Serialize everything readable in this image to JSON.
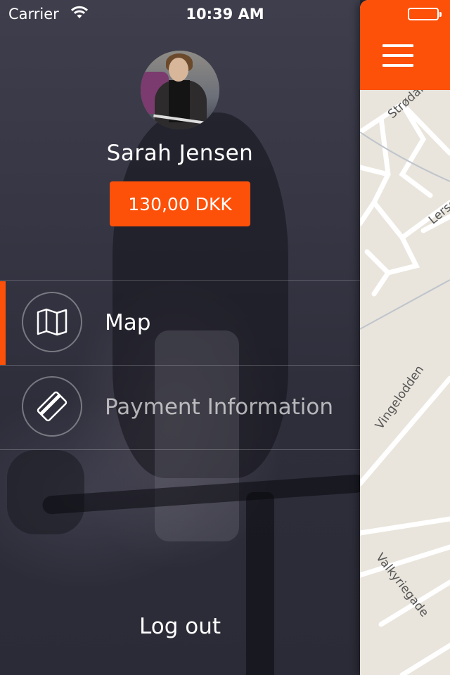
{
  "status_bar": {
    "carrier": "Carrier",
    "time": "10:39 AM",
    "wifi_icon": "wifi-icon",
    "battery_icon": "battery-full-icon"
  },
  "profile": {
    "name": "Sarah Jensen",
    "balance": "130,00 DKK",
    "avatar_icon": "user-avatar-photo"
  },
  "menu": {
    "items": [
      {
        "label": "Map",
        "icon": "map-icon",
        "active": true
      },
      {
        "label": "Payment Information",
        "icon": "credit-card-icon",
        "active": false
      }
    ]
  },
  "logout_label": "Log out",
  "map": {
    "streets": [
      "Strødam",
      "Lerse",
      "Vingelodden",
      "Valkyriegade"
    ]
  },
  "colors": {
    "accent": "#fd5009",
    "drawer_bg": "#2e2e3b",
    "map_bg": "#e9e5dc",
    "text": "#ffffff"
  }
}
